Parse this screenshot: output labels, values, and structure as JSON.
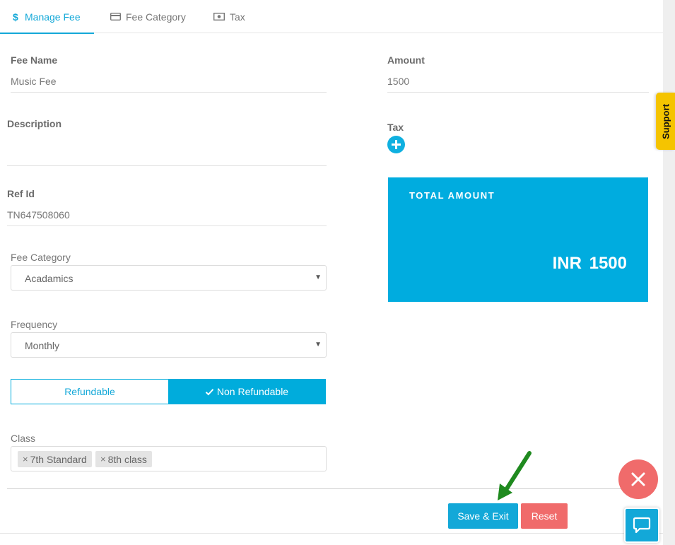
{
  "tabs": [
    {
      "label": "Manage Fee",
      "icon": "dollar-icon"
    },
    {
      "label": "Fee Category",
      "icon": "credit-card-icon"
    },
    {
      "label": "Tax",
      "icon": "money-icon"
    }
  ],
  "form": {
    "fee_name_label": "Fee Name",
    "fee_name_value": "Music Fee",
    "description_label": "Description",
    "description_value": "",
    "ref_id_label": "Ref Id",
    "ref_id_value": "TN647508060",
    "fee_category_label": "Fee Category",
    "fee_category_value": "Acadamics",
    "frequency_label": "Frequency",
    "frequency_value": "Monthly",
    "refund_options": [
      "Refundable",
      "Non Refundable"
    ],
    "refund_selected": "Non Refundable",
    "class_label": "Class",
    "class_tags": [
      "7th Standard",
      "8th class"
    ],
    "amount_label": "Amount",
    "amount_value": "1500",
    "tax_label": "Tax"
  },
  "total": {
    "label": "TOTAL AMOUNT",
    "value": "INR 1500"
  },
  "actions": {
    "save_exit": "Save & Exit",
    "reset": "Reset"
  },
  "support_label": "Support",
  "colors": {
    "accent": "#00acdf",
    "danger": "#f06b6b",
    "support": "#f5c400",
    "arrow": "#1f8a1f"
  }
}
